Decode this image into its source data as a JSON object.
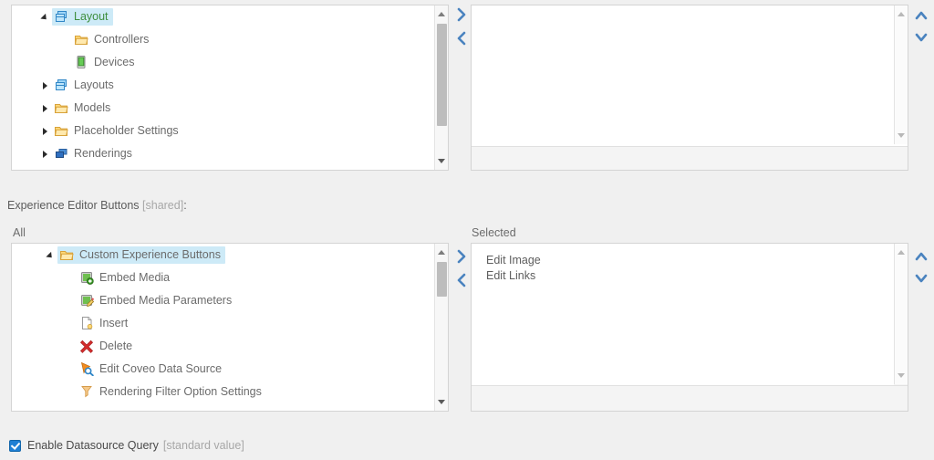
{
  "page": {
    "background": "#f0f0f0",
    "accent": "#4a83bf",
    "selection_highlight": "#cdeaf7"
  },
  "layout_tree": {
    "panel_name": "layout-tree-panel",
    "nodes": [
      {
        "label": "Layout",
        "icon": "layout-stack-icon",
        "indent": 0,
        "expander": "collapse",
        "selected": true,
        "label_color": "#3f8f3f"
      },
      {
        "label": "Controllers",
        "icon": "folder-icon",
        "indent": 1,
        "expander": "none",
        "selected": false,
        "label_color": "#6b6b6b"
      },
      {
        "label": "Devices",
        "icon": "device-icon",
        "indent": 1,
        "expander": "none",
        "selected": false,
        "label_color": "#6b6b6b"
      },
      {
        "label": "Layouts",
        "icon": "layout-stack-icon",
        "indent": 1,
        "expander": "expand",
        "selected": false,
        "label_color": "#6b6b6b"
      },
      {
        "label": "Models",
        "icon": "folder-icon",
        "indent": 1,
        "expander": "expand",
        "selected": false,
        "label_color": "#6b6b6b"
      },
      {
        "label": "Placeholder Settings",
        "icon": "folder-icon",
        "indent": 1,
        "expander": "expand",
        "selected": false,
        "label_color": "#6b6b6b"
      },
      {
        "label": "Renderings",
        "icon": "renderings-icon",
        "indent": 1,
        "expander": "expand",
        "selected": false,
        "label_color": "#6b6b6b"
      }
    ],
    "scrollbar": {
      "thumb_top_pct": 11,
      "thumb_height_pct": 62
    }
  },
  "layout_selected_panel": {
    "panel_name": "layout-selected-panel",
    "items": [],
    "scrollbar": {
      "thumb_top_pct": 0,
      "thumb_height_pct": 0
    }
  },
  "experience_editor_buttons": {
    "label": "Experience Editor Buttons",
    "shared_tag": "[shared]",
    "colon": ":",
    "all_label": "All",
    "selected_label": "Selected",
    "all_tree": {
      "nodes": [
        {
          "label": "Custom Experience Buttons",
          "icon": "folder-icon",
          "indent": 0,
          "expander": "collapse",
          "selected": true
        },
        {
          "label": "Embed Media",
          "icon": "embed-media-icon",
          "indent": 1,
          "expander": "none",
          "selected": false
        },
        {
          "label": "Embed Media Parameters",
          "icon": "embed-media-params-icon",
          "indent": 1,
          "expander": "none",
          "selected": false
        },
        {
          "label": "Insert",
          "icon": "insert-page-icon",
          "indent": 1,
          "expander": "none",
          "selected": false
        },
        {
          "label": "Delete",
          "icon": "delete-x-icon",
          "indent": 1,
          "expander": "none",
          "selected": false
        },
        {
          "label": "Edit Coveo Data Source",
          "icon": "edit-coveo-icon",
          "indent": 1,
          "expander": "none",
          "selected": false
        },
        {
          "label": "Rendering Filter Option Settings",
          "icon": "filter-funnel-icon",
          "indent": 1,
          "expander": "none",
          "selected": false
        }
      ],
      "scrollbar": {
        "thumb_top_pct": 10,
        "thumb_height_pct": 20
      }
    },
    "selected_list": {
      "items": [
        "Edit Image",
        "Edit Links"
      ],
      "scrollbar": {
        "thumb_top_pct": 0,
        "thumb_height_pct": 0
      }
    }
  },
  "transfer_controls": {
    "add_icon": "chevron-right-icon",
    "remove_icon": "chevron-left-icon",
    "move_up_icon": "chevron-up-icon",
    "move_down_icon": "chevron-down-icon"
  },
  "enable_datasource_query": {
    "label": "Enable Datasource Query",
    "value_tag": "[standard value]",
    "checked": true
  }
}
